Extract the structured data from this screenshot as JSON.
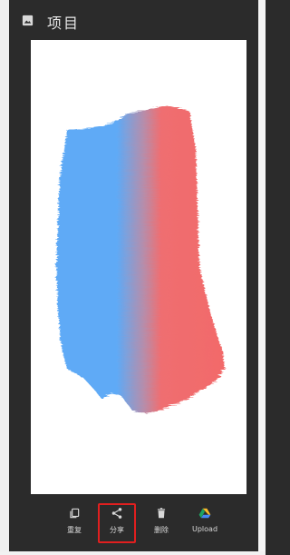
{
  "header": {
    "title": "项目",
    "icon": "image-icon"
  },
  "canvas": {
    "background": "#ffffff",
    "stroke_colors": [
      "#5aa8f6",
      "#f26565"
    ]
  },
  "actions": [
    {
      "label": "重复",
      "icon": "copy-icon"
    },
    {
      "label": "分享",
      "icon": "share-icon",
      "selected": true,
      "highlight": "#e11f1f"
    },
    {
      "label": "删除",
      "icon": "delete-icon"
    },
    {
      "label": "Upload",
      "icon": "google-drive-icon"
    }
  ]
}
